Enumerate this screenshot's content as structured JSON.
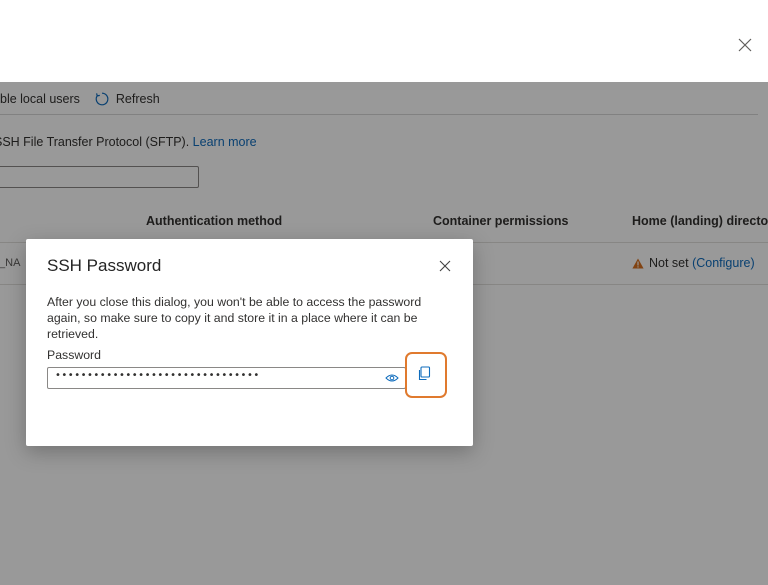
{
  "toolbar": {
    "enable_local_users": "ble local users",
    "refresh": "Refresh"
  },
  "page": {
    "description": "SSH File Transfer Protocol (SFTP).",
    "learn_more": "Learn more"
  },
  "table": {
    "headers": {
      "auth": "Authentication method",
      "container": "Container permissions",
      "home": "Home (landing) director"
    },
    "row": {
      "name": "I_NA",
      "home_status": "Not set",
      "home_link": "(Configure)"
    }
  },
  "dialog": {
    "title": "SSH Password",
    "message": "After you close this dialog, you won't be able to access the password again, so make sure to copy it and store it in a place where it can be retrieved.",
    "password_label": "Password",
    "password_value": "••••••••••••••••••••••••••••••••"
  },
  "colors": {
    "accent": "#0f6cbd",
    "warning": "#d8701f",
    "highlight": "#e07a2e"
  },
  "icons": [
    "close-icon",
    "refresh-icon",
    "warning-icon",
    "eye-icon",
    "copy-icon"
  ]
}
